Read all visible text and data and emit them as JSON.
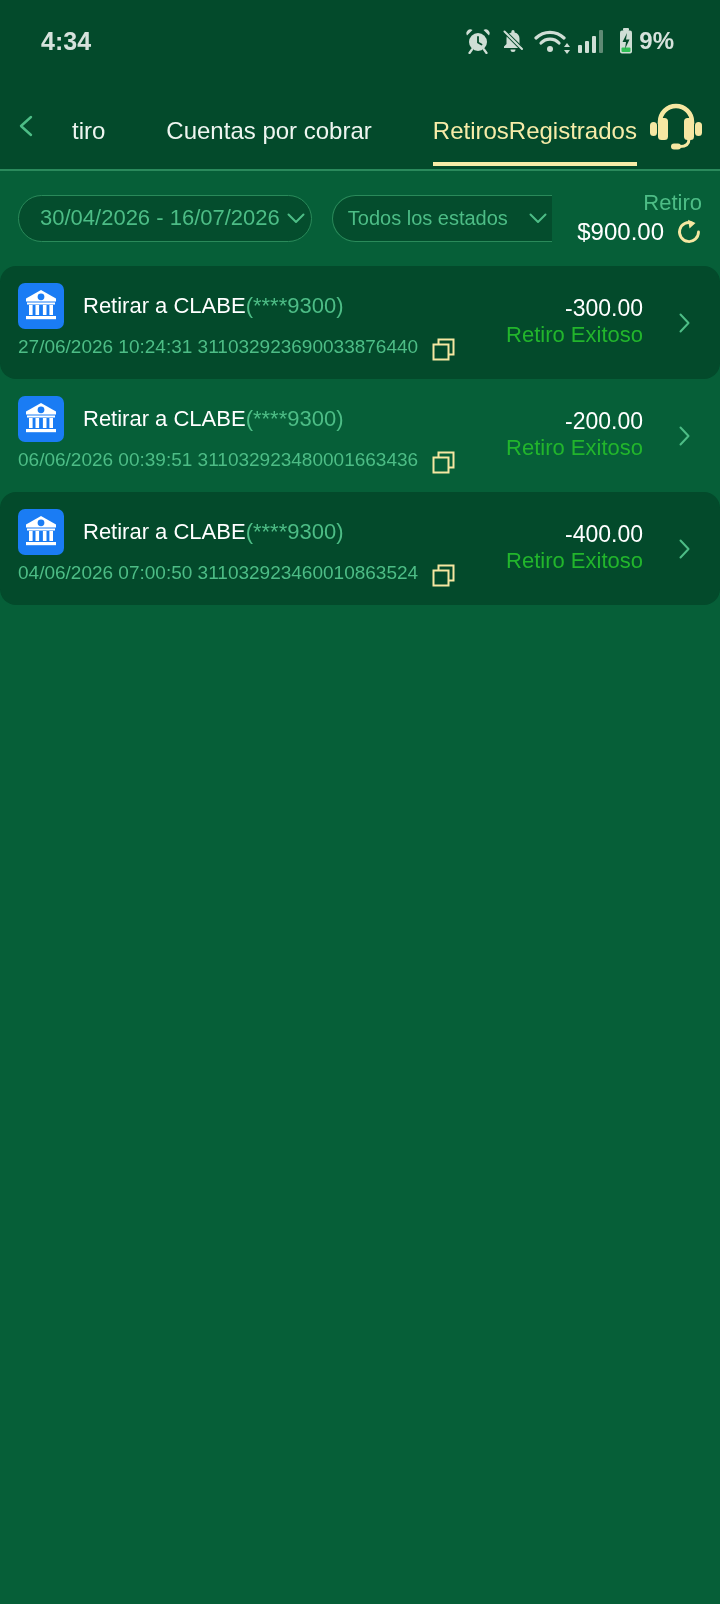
{
  "status_bar": {
    "time": "4:34",
    "battery": "9%"
  },
  "header": {
    "tabs": [
      {
        "label": "tiro",
        "selected": false
      },
      {
        "label": "Cuentas por cobrar",
        "selected": false
      },
      {
        "label": "RetirosRegistrados",
        "selected": true
      }
    ]
  },
  "filters": {
    "date_range": "30/04/2026 - 16/07/2026",
    "status": "Todos los estados"
  },
  "summary": {
    "label": "Retiro",
    "amount": "$900.00"
  },
  "transactions": [
    {
      "title": "Retirar a CLABE",
      "account": "(****9300)",
      "details": "27/06/2026 10:24:31 311032923690033876440",
      "amount": "-300.00",
      "status": "Retiro Exitoso"
    },
    {
      "title": "Retirar a CLABE",
      "account": "(****9300)",
      "details": "06/06/2026 00:39:51 311032923480001663436",
      "amount": "-200.00",
      "status": "Retiro Exitoso"
    },
    {
      "title": "Retirar a CLABE",
      "account": "(****9300)",
      "details": "04/06/2026 07:00:50 311032923460010863524",
      "amount": "-400.00",
      "status": "Retiro Exitoso"
    }
  ]
}
